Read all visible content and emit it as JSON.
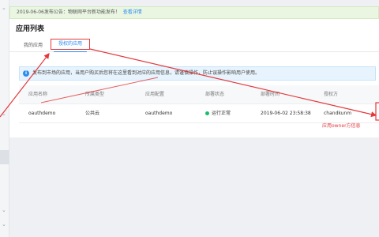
{
  "notice": {
    "text": "2019-06-06发布公告：物联网平台新功能发布！",
    "link": "查看详情"
  },
  "page": {
    "title": "应用列表"
  },
  "tabs": [
    {
      "label": "我的应用",
      "active": false
    },
    {
      "label": "授权的应用",
      "active": true
    }
  ],
  "info": {
    "icon": "info-icon",
    "text": "发布到市场的应用，当用户购买后您将在这里看到对应的应用信息，请谨慎操作，防止误操作影响用户使用。"
  },
  "table": {
    "headers": [
      "应用名称",
      "所属类型",
      "应用配置",
      "部署状态",
      "部署时间",
      "授权方"
    ],
    "rows": [
      {
        "name": "oauthdemo",
        "type": "公共云",
        "config": "oauthdemo",
        "status": "运行正常",
        "time": "2019-06-02 23:58:38",
        "owner": "chandkunm"
      }
    ]
  },
  "annotation": {
    "text": "应用owner方信息",
    "color": "#e4393c"
  },
  "colors": {
    "accent": "#2d8cf0",
    "success": "#19be6b",
    "highlight": "#e4393c"
  }
}
